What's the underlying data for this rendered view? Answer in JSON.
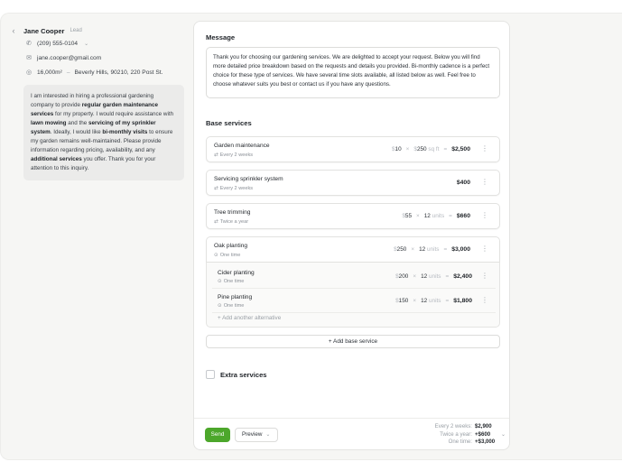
{
  "lead": {
    "name": "Jane Cooper",
    "badge": "Lead",
    "phone": "(209) 555-0104",
    "email": "jane.cooper@gmail.com",
    "area": "16,000m²",
    "address": "Beverly Hills, 90210, 220 Post St.",
    "inquiry_parts": [
      "I am interested in hiring a professional gardening company to provide ",
      "regular garden maintenance services",
      " for my property. I would require assistance with ",
      "lawn mowing",
      " and the ",
      "servicing of my sprinkler system",
      ". Ideally, I would like ",
      "bi-monthly visits",
      " to ensure my garden remains well-maintained. Please provide information regarding pricing, availability, and any ",
      "additional services",
      " you offer. Thank you for your attention to this inquiry."
    ]
  },
  "message": {
    "title": "Message",
    "body": "Thank you for choosing our gardening services. We are delighted to accept your request. Below you will find more detailed price breakdown based on the requests and details you provided. Bi-monthly cadence is a perfect choice for these type of services. We have several time slots available, all listed below as well. Feel free to choose whatever suits you best or contact us if you have any questions."
  },
  "base_services": {
    "title": "Base services",
    "items": [
      {
        "name": "Garden maintenance",
        "frequency": "Every 2 weeks",
        "freq_icon": "repeat-icon",
        "rate": "10",
        "qty": "250",
        "unit": "sq ft",
        "total": "$2,500"
      },
      {
        "name": "Servicing sprinkler system",
        "frequency": "Every 2 weeks",
        "freq_icon": "repeat-icon",
        "total": "$400"
      },
      {
        "name": "Tree trimming",
        "frequency": "Twice a year",
        "freq_icon": "repeat-icon",
        "rate": "55",
        "qty": "12",
        "unit": "units",
        "total": "$660"
      },
      {
        "name": "Oak planting",
        "frequency": "One time",
        "freq_icon": "one-time-icon",
        "rate": "250",
        "qty": "12",
        "unit": "units",
        "total": "$3,000"
      }
    ],
    "alternatives": [
      {
        "name": "Cider planting",
        "frequency": "One time",
        "rate": "200",
        "qty": "12",
        "unit": "units",
        "total": "$2,400"
      },
      {
        "name": "Pine planting",
        "frequency": "One time",
        "rate": "150",
        "qty": "12",
        "unit": "units",
        "total": "$1,800"
      }
    ],
    "add_alternative_label": "+ Add another alternative",
    "add_base_label": "+ Add base service"
  },
  "extra_services": {
    "label": "Extra services"
  },
  "footer": {
    "send_label": "Send",
    "preview_label": "Preview",
    "totals": [
      {
        "label": "Every 2 weeks:",
        "amount": "$2,900"
      },
      {
        "label": "Twice a year:",
        "amount": "+$600"
      },
      {
        "label": "One time:",
        "amount": "+$3,000"
      }
    ]
  },
  "symbols": {
    "currency": "$",
    "times": "×",
    "equals": "="
  }
}
